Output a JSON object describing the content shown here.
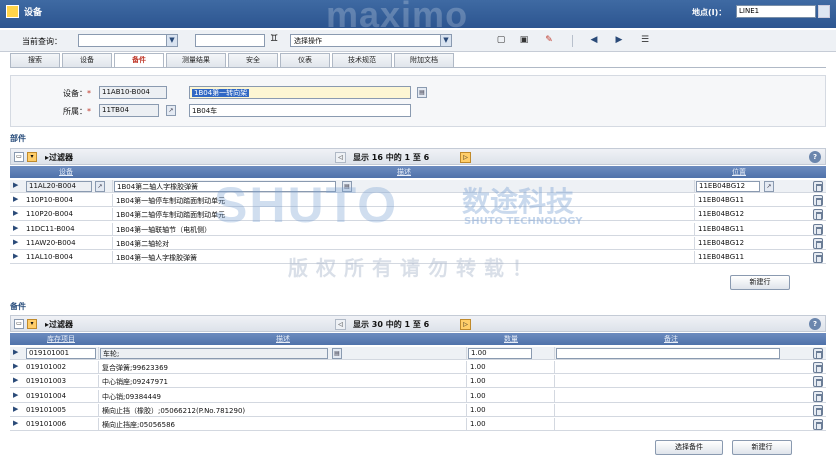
{
  "app": {
    "title": "设备",
    "brand": "maximo",
    "site_label": "地点(I)：",
    "site_value": "LINE1"
  },
  "toolbar": {
    "query_label": "当前查询：",
    "action_select": "选择操作"
  },
  "tabs": [
    "搜索",
    "设备",
    "备件",
    "测量结果",
    "安全",
    "仪表",
    "技术规范",
    "附加文档"
  ],
  "header": {
    "asset_label": "设备：",
    "asset_value": "11AB10-B004",
    "asset_desc": "1B04第一转向架",
    "parent_label": "所属：",
    "parent_value": "11TB04",
    "parent_desc": "1B04车"
  },
  "parts": {
    "title": "部件",
    "filter": "过滤器",
    "count_text": "显示 16 中的 1 至 6",
    "columns": [
      "设备",
      "描述",
      "位置"
    ],
    "rows": [
      {
        "asset": "11AL20-B004",
        "desc": "1B04第二轴人字橡胶弹簧",
        "loc": "11EB04BG12"
      },
      {
        "asset": "110P10-B004",
        "desc": "1B04第一轴停车制动踏面制动单元",
        "loc": "11EB04BG11"
      },
      {
        "asset": "110P20-B004",
        "desc": "1B04第二轴停车制动踏面制动单元",
        "loc": "11EB04BG12"
      },
      {
        "asset": "11DC11-B004",
        "desc": "1B04第一轴联轴节（电机侧）",
        "loc": "11EB04BG11"
      },
      {
        "asset": "11AW20-B004",
        "desc": "1B04第二轴轮对",
        "loc": "11EB04BG12"
      },
      {
        "asset": "11AL10-B004",
        "desc": "1B04第一轴人字橡胶弹簧",
        "loc": "11EB04BG11"
      }
    ],
    "new_row_button": "新建行"
  },
  "spares": {
    "title": "备件",
    "filter": "过滤器",
    "count_text": "显示 30 中的 1 至 6",
    "columns": [
      "库存项目",
      "描述",
      "数量",
      "备注"
    ],
    "rows": [
      {
        "item": "019101001",
        "desc": "车轮;",
        "qty": "1.00"
      },
      {
        "item": "019101002",
        "desc": "复合弹簧;99623369",
        "qty": "1.00"
      },
      {
        "item": "019101003",
        "desc": "中心销座;09247971",
        "qty": "1.00"
      },
      {
        "item": "019101004",
        "desc": "中心销;09384449",
        "qty": "1.00"
      },
      {
        "item": "019101005",
        "desc": "横向止挡（橡胶）;05066212(P.No.781290)",
        "qty": "1.00"
      },
      {
        "item": "019101006",
        "desc": "横向止挡座;05056586",
        "qty": "1.00"
      }
    ],
    "select_button": "选择备件",
    "new_row_button": "新建行"
  },
  "watermark": {
    "brand_en": "SHUTO",
    "brand_cn": "数途科技",
    "brand_sub": "SHUTO TECHNOLOGY",
    "notice": "版权所有请勿转载！"
  },
  "colors": {
    "titlebar": "#2c5590",
    "grid_header": "#5a7cb3",
    "active_tab": "#c0392b"
  }
}
